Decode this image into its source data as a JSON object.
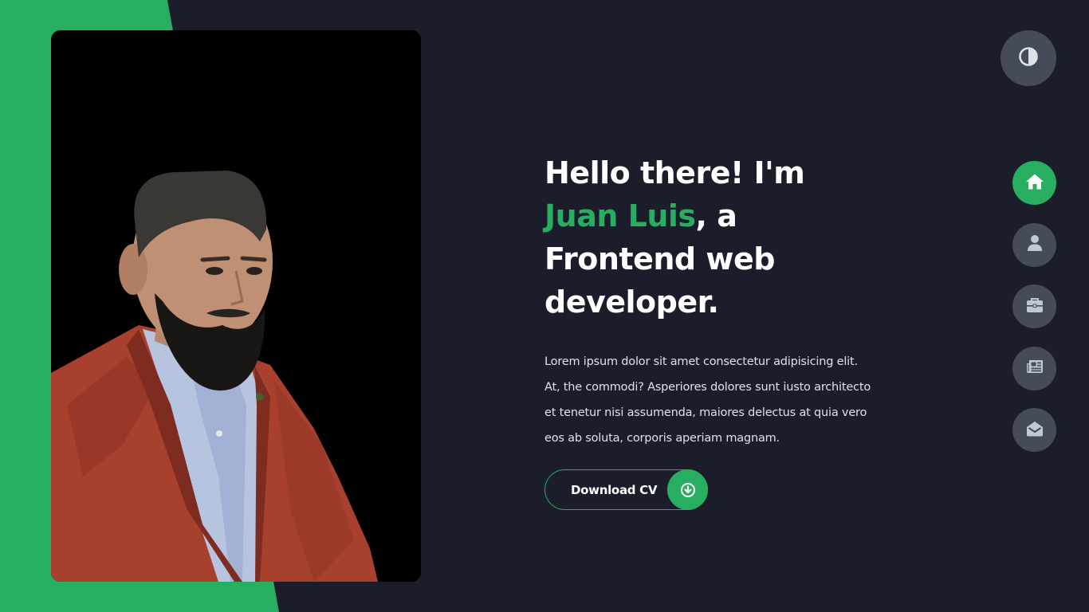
{
  "colors": {
    "accent": "#27ae60",
    "background": "#1b1d2b",
    "nav_button": "#454b59",
    "text": "#ffffff"
  },
  "hero": {
    "title_prefix": "Hello there! I'm ",
    "title_name": "Juan Luis",
    "title_suffix": ", a Frontend web developer.",
    "description": "Lorem ipsum dolor sit amet consectetur adipisicing elit. At, the commodi? Asperiores dolores sunt iusto architecto et tenetur nisi assumenda, maiores delectus at quia vero eos ab soluta, corporis aperiam magnam.",
    "button_label": "Download CV",
    "button_icon": "download-circle-icon"
  },
  "theme_toggle": {
    "icon": "contrast-icon"
  },
  "nav": [
    {
      "id": "home",
      "icon": "home-icon",
      "active": true
    },
    {
      "id": "about",
      "icon": "user-icon",
      "active": false
    },
    {
      "id": "portfolio",
      "icon": "briefcase-icon",
      "active": false
    },
    {
      "id": "blogs",
      "icon": "newspaper-icon",
      "active": false
    },
    {
      "id": "contact",
      "icon": "envelope-open-icon",
      "active": false
    }
  ]
}
